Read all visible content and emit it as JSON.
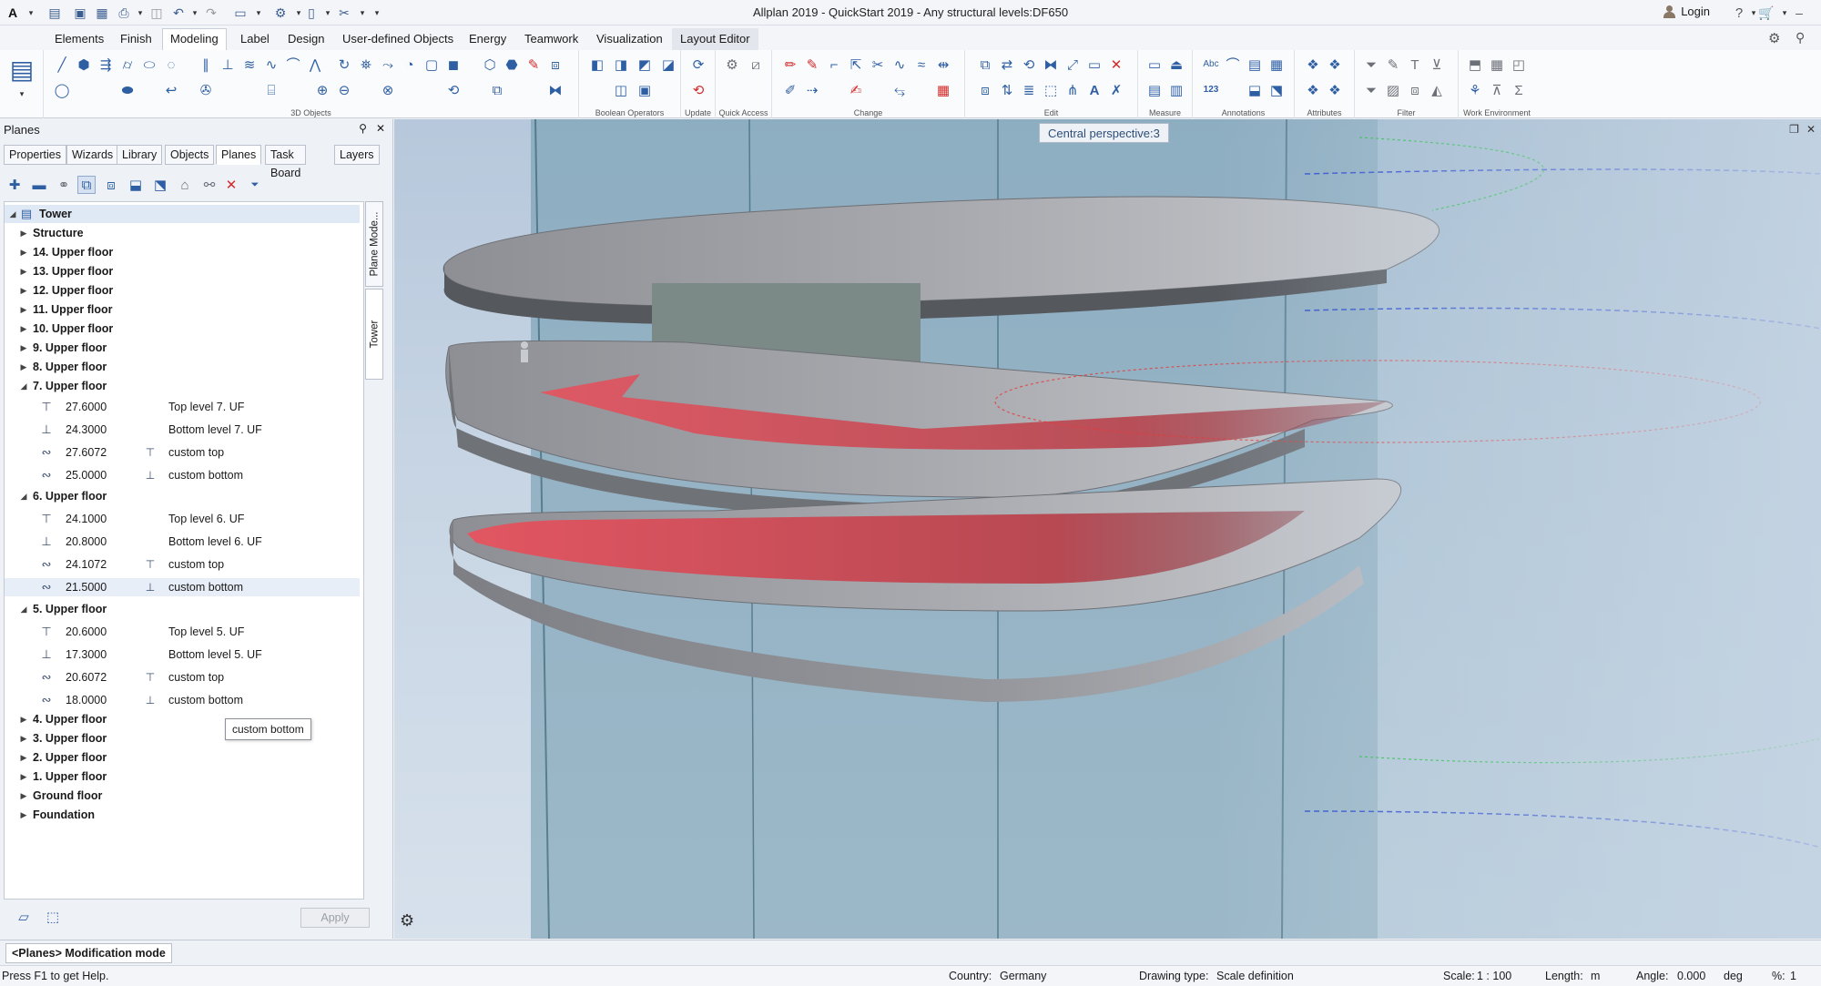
{
  "window": {
    "title": "Allplan 2019 - QuickStart 2019 - Any structural levels:DF650",
    "login_label": "Login",
    "help_label": "?"
  },
  "ribbon_tabs": [
    "Elements",
    "Finish",
    "Modeling",
    "Label",
    "Design",
    "User-defined Objects",
    "Energy",
    "Teamwork",
    "Visualization",
    "Layout Editor"
  ],
  "active_ribbon_tab": "Modeling",
  "ribbon_groups": [
    "3D Objects",
    "Boolean Operators",
    "Update",
    "Quick Access",
    "Change",
    "Edit",
    "Measure",
    "Annotations",
    "Attributes",
    "Filter",
    "Work Environment"
  ],
  "panel": {
    "title": "Planes",
    "tabs": [
      "Properties",
      "Wizards",
      "Library",
      "Objects",
      "Planes",
      "Task Board",
      "Layers"
    ],
    "active_tab": "Planes",
    "vertical_tabs": [
      "Plane Mode...",
      "Tower"
    ],
    "apply_label": "Apply",
    "tooltip": "custom bottom"
  },
  "tree": {
    "root": "Tower",
    "top_items": [
      "Structure",
      "14. Upper floor",
      "13. Upper floor",
      "12. Upper floor",
      "11. Upper floor",
      "10. Upper floor",
      "9. Upper floor",
      "8. Upper floor"
    ],
    "floor7": {
      "label": "7. Upper floor",
      "rows": [
        {
          "value": "27.6000",
          "label": "Top level 7. UF"
        },
        {
          "value": "24.3000",
          "label": "Bottom level 7. UF"
        },
        {
          "value": "27.6072",
          "label": "custom top"
        },
        {
          "value": "25.0000",
          "label": "custom bottom"
        }
      ]
    },
    "floor6": {
      "label": "6. Upper floor",
      "rows": [
        {
          "value": "24.1000",
          "label": "Top level 6. UF"
        },
        {
          "value": "20.8000",
          "label": "Bottom level 6. UF"
        },
        {
          "value": "24.1072",
          "label": "custom top"
        },
        {
          "value": "21.5000",
          "label": "custom bottom"
        }
      ]
    },
    "floor5": {
      "label": "5. Upper floor",
      "rows": [
        {
          "value": "20.6000",
          "label": "Top level 5. UF"
        },
        {
          "value": "17.3000",
          "label": "Bottom level 5. UF"
        },
        {
          "value": "20.6072",
          "label": "custom top"
        },
        {
          "value": "18.0000",
          "label": "custom bottom"
        }
      ]
    },
    "bottom_items": [
      "4. Upper floor",
      "3. Upper floor",
      "2. Upper floor",
      "1. Upper floor",
      "Ground floor",
      "Foundation"
    ]
  },
  "viewport": {
    "label": "Central perspective:3"
  },
  "mode": "<Planes> Modification mode",
  "statusbar": {
    "help": "Press F1 to get Help.",
    "country_label": "Country:",
    "country": "Germany",
    "drawing_type_label": "Drawing type:",
    "drawing_type": "Scale definition",
    "scale_label": "Scale:",
    "scale": "1 : 100",
    "length_label": "Length:",
    "length_unit": "m",
    "angle_label": "Angle:",
    "angle": "0.000",
    "angle_unit": "deg",
    "percent_label": "%:",
    "percent": "1"
  },
  "colors": {
    "accent": "#2f5fa3",
    "slab_gray": "#8f9196",
    "plane_red": "#e0404e",
    "glass": "#6e9bb0"
  }
}
